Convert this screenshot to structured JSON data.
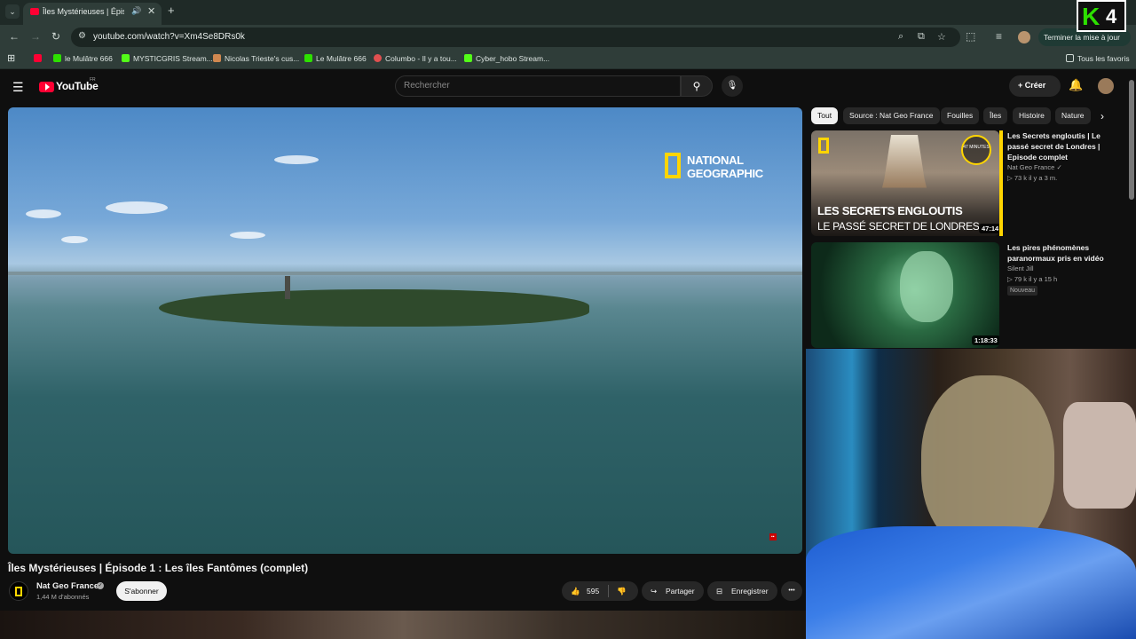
{
  "browser": {
    "tab_title": "Îles Mystérieuses | Épisode",
    "tab_close": "✕",
    "new_tab": "+",
    "url": "youtube.com/watch?v=Xm4Se8DRs0k",
    "update_button": "Terminer la mise à jour",
    "bookmarks": [
      {
        "label": "le Mulâtre 666",
        "color": "#2de000"
      },
      {
        "label": "MYSTICGRIS Stream...",
        "color": "#53fc18"
      },
      {
        "label": "Nicolas Trieste's cus...",
        "color": "#d08850"
      },
      {
        "label": "Le Mulâtre 666",
        "color": "#2de000"
      },
      {
        "label": "Columbo - Il y a tou...",
        "color": "#e05050"
      },
      {
        "label": "Cyber_hobo Stream...",
        "color": "#53fc18"
      }
    ],
    "all_bookmarks": "Tous les favoris",
    "overlay_logo": {
      "k": "K",
      "four": "4"
    }
  },
  "youtube": {
    "wordmark": "YouTube",
    "country": "FR",
    "search_placeholder": "Rechercher",
    "create_label": "+ Créer",
    "brand_color": "#ff0033"
  },
  "video": {
    "watermark": "NATIONAL\nGEOGRAPHIC",
    "watermark_line1": "NATIONAL",
    "watermark_line2": "GEOGRAPHIC",
    "title": "Îles Mystérieuses | Épisode 1 : Les îles Fantômes (complet)",
    "channel": "Nat Geo France",
    "subscribers": "1,44 M d'abonnés",
    "subscribe_label": "S'abonner",
    "likes": "595",
    "share_label": "Partager",
    "save_label": "Enregistrer",
    "more_label": "•••"
  },
  "chips": [
    "Tout",
    "Source : Nat Geo France",
    "Fouilles",
    "Îles",
    "Histoire",
    "Nature"
  ],
  "recommendations": [
    {
      "title": "Les Secrets engloutis | Le passé secret de Londres | Episode complet",
      "channel": "Nat Geo France",
      "meta": "▷ 73 k   il y a 3 m.",
      "duration": "47:14",
      "thumb_line1": "LES SECRETS ENGLOUTIS",
      "thumb_line2": "LE PASSÉ SECRET DE LONDRES",
      "badge": "47 MINUTES"
    },
    {
      "title": "Les pires phénomènes paranormaux pris en vidéo",
      "channel": "Silent Jill",
      "meta": "▷ 79 k   il y a 15 h",
      "duration": "1:18:33",
      "badge": "Nouveau"
    }
  ]
}
